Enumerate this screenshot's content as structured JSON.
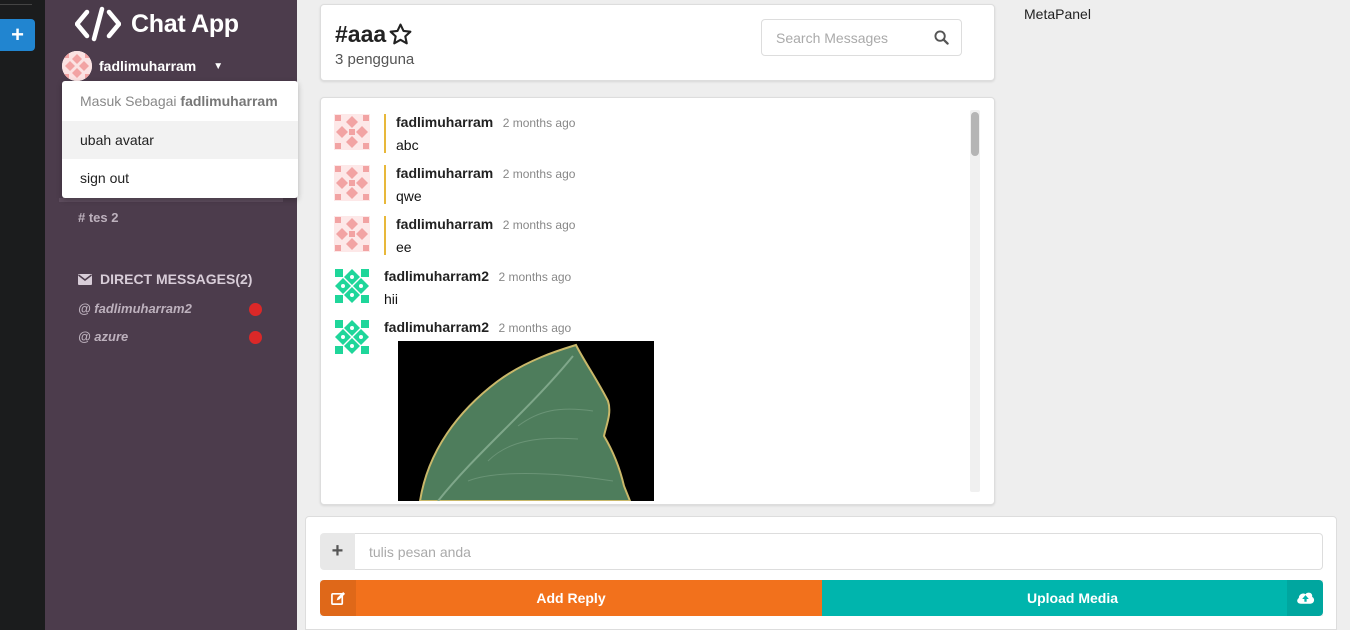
{
  "app": {
    "title": "Chat App"
  },
  "user": {
    "name": "fadlimuharram"
  },
  "dropdown": {
    "signed_in_prefix": "Masuk Sebagai",
    "signed_in_name": "fadlimuharram",
    "items": [
      {
        "label": "ubah avatar"
      },
      {
        "label": "sign out"
      }
    ]
  },
  "sidebar": {
    "channels": [
      {
        "label": "# tes 2"
      }
    ],
    "direct_messages": {
      "header": "DIRECT MESSAGES(2)",
      "items": [
        {
          "label": "@ fadlimuharram2"
        },
        {
          "label": "@ azure"
        }
      ]
    }
  },
  "channel": {
    "name": "#aaa",
    "member_count": "3 pengguna",
    "search_placeholder": "Search Messages"
  },
  "messages": [
    {
      "author": "fadlimuharram",
      "time": "2 months ago",
      "text": "abc"
    },
    {
      "author": "fadlimuharram",
      "time": "2 months ago",
      "text": "qwe"
    },
    {
      "author": "fadlimuharram",
      "time": "2 months ago",
      "text": "ee"
    },
    {
      "author": "fadlimuharram2",
      "time": "2 months ago",
      "text": "hii"
    },
    {
      "author": "fadlimuharram2",
      "time": "2 months ago",
      "text": ""
    }
  ],
  "composer": {
    "placeholder": "tulis pesan anda",
    "reply_label": "Add Reply",
    "upload_label": "Upload Media"
  },
  "meta_panel": {
    "title": "MetaPanel"
  },
  "colors": {
    "sidebar_bg": "#4c3c4c",
    "rail_bg": "#1b1c1d",
    "primary": "#2185d0",
    "reply": "#f2711c",
    "upload": "#00b5ad",
    "own_message_border": "#e8b83a",
    "notification_dot": "#db2828"
  }
}
